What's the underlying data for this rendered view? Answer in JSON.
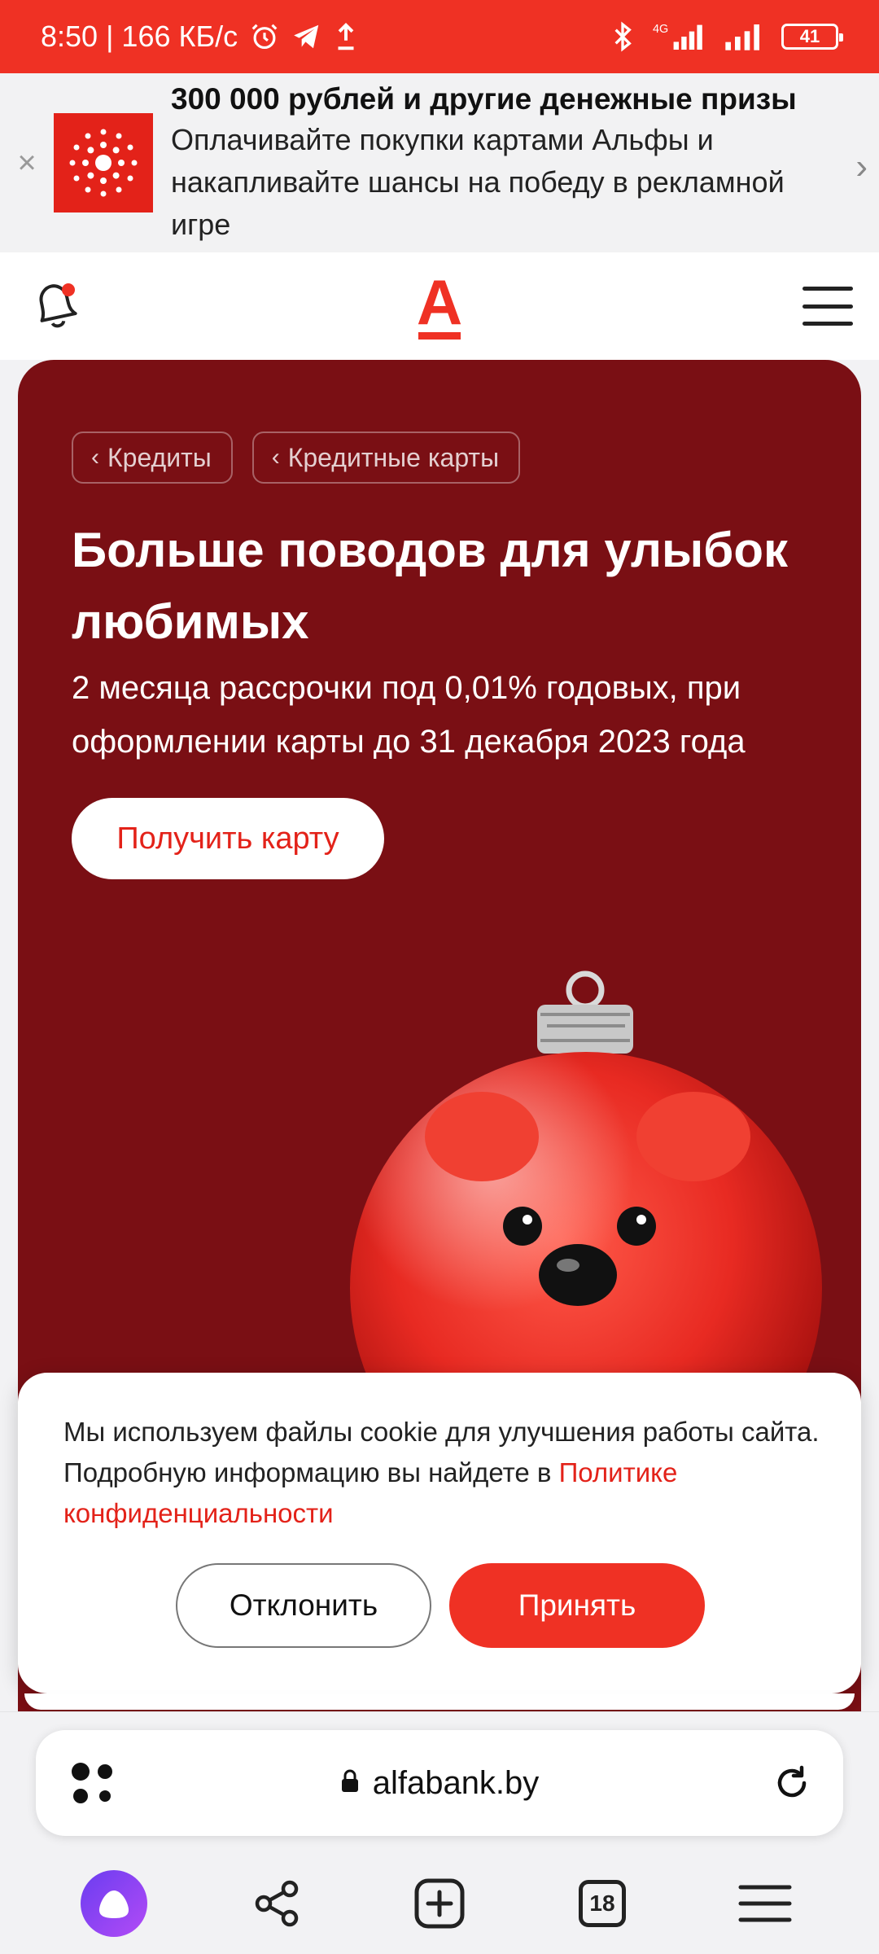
{
  "status_bar": {
    "time_speed": "8:50 | 166 КБ/с",
    "network": "4G",
    "battery": "41"
  },
  "promo": {
    "title": "300 000 рублей и другие денежные призы",
    "description": "Оплачивайте покупки картами Альфы и накапливайте шансы на победу в рекламной игре",
    "close_icon": "×",
    "next_icon": "›"
  },
  "header": {
    "logo_letter": "А"
  },
  "hero": {
    "breadcrumbs": [
      {
        "label": "Кредиты"
      },
      {
        "label": "Кредитные карты"
      }
    ],
    "title": "Больше поводов для улыбок любимых",
    "subtitle": "2 месяца рассрочки под 0,01% годовых, при оформлении карты до 31 декабря 2023 года",
    "cta_label": "Получить карту"
  },
  "cookie": {
    "message": "Мы используем файлы cookie для улучшения работы сайта. Подробную информацию вы найдете в ",
    "link_text": "Политике конфиденциальности",
    "decline_label": "Отклонить",
    "accept_label": "Принять"
  },
  "browser": {
    "url": "alfabank.by",
    "tabs_count": "18"
  },
  "colors": {
    "brand_red": "#ef3124",
    "hero_bg": "#7a0f14"
  }
}
